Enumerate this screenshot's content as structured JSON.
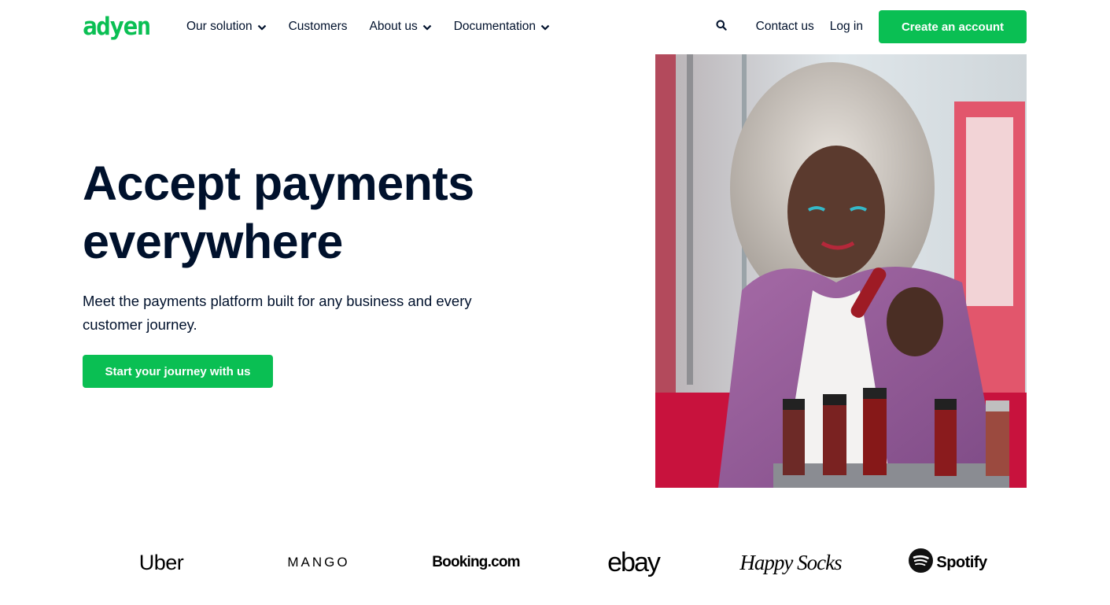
{
  "brand": {
    "name": "adyen",
    "accent": "#0abf53",
    "text_color": "#00112c"
  },
  "nav": {
    "items": [
      {
        "label": "Our solution",
        "has_dropdown": true
      },
      {
        "label": "Customers",
        "has_dropdown": false
      },
      {
        "label": "About us",
        "has_dropdown": true
      },
      {
        "label": "Documentation",
        "has_dropdown": true
      }
    ],
    "search_icon": "search-icon",
    "contact_label": "Contact us",
    "login_label": "Log in",
    "create_account_label": "Create an account"
  },
  "hero": {
    "title_line1": "Accept payments",
    "title_line2": "everywhere",
    "subtitle": "Meet the payments platform built for any business and every customer journey.",
    "cta_label": "Start your journey with us"
  },
  "customer_logos": [
    {
      "name": "Uber"
    },
    {
      "name": "MANGO"
    },
    {
      "name": "Booking.com"
    },
    {
      "name": "ebay"
    },
    {
      "name": "Happy Socks"
    },
    {
      "name": "Spotify"
    }
  ]
}
